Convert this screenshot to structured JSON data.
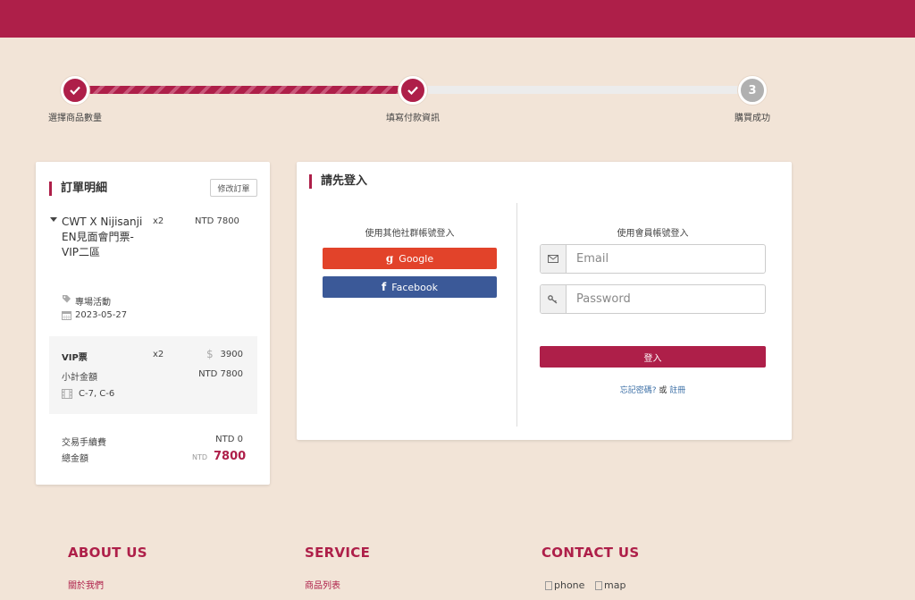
{
  "progress": {
    "steps": [
      {
        "label": "選擇商品數量",
        "state": "done"
      },
      {
        "label": "填寫付款資訊",
        "state": "done"
      },
      {
        "label": "購買成功",
        "state": "todo",
        "number": "3"
      }
    ]
  },
  "order": {
    "title": "訂單明細",
    "edit_label": "修改訂單",
    "product": {
      "name": "CWT X Nijisanji EN見面會門票-VIP二區",
      "qty": "x2",
      "price": "NTD 7800",
      "category": "專場活動",
      "date": "2023-05-27"
    },
    "ticket": {
      "name": "VIP票",
      "qty": "x2",
      "currency_symbol": "$",
      "unit_price": "3900",
      "subtotal_label": "小計金額",
      "subtotal": "NTD 7800",
      "seats": "C-7, C-6"
    },
    "fee_label": "交易手續費",
    "fee": "NTD 0",
    "total_label": "總金額",
    "total_currency": "NTD",
    "total": "7800"
  },
  "login": {
    "title": "請先登入",
    "social_heading": "使用其他社群帳號登入",
    "google_label": "Google",
    "facebook_label": "Facebook",
    "member_heading": "使用會員帳號登入",
    "email_placeholder": "Email",
    "password_placeholder": "Password",
    "submit_label": "登入",
    "forgot_label": "忘記密碼?",
    "or_label": "或",
    "register_label": "註冊"
  },
  "footer": {
    "about_heading": "ABOUT US",
    "about_link": "關於我們",
    "service_heading": "SERVICE",
    "service_link": "商品列表",
    "contact_heading": "CONTACT US",
    "phone_alt": "phone",
    "map_alt": "map"
  },
  "colors": {
    "brand": "#ae1f49",
    "google": "#e2432a",
    "facebook": "#3b5998",
    "background": "#f2e4d7"
  }
}
